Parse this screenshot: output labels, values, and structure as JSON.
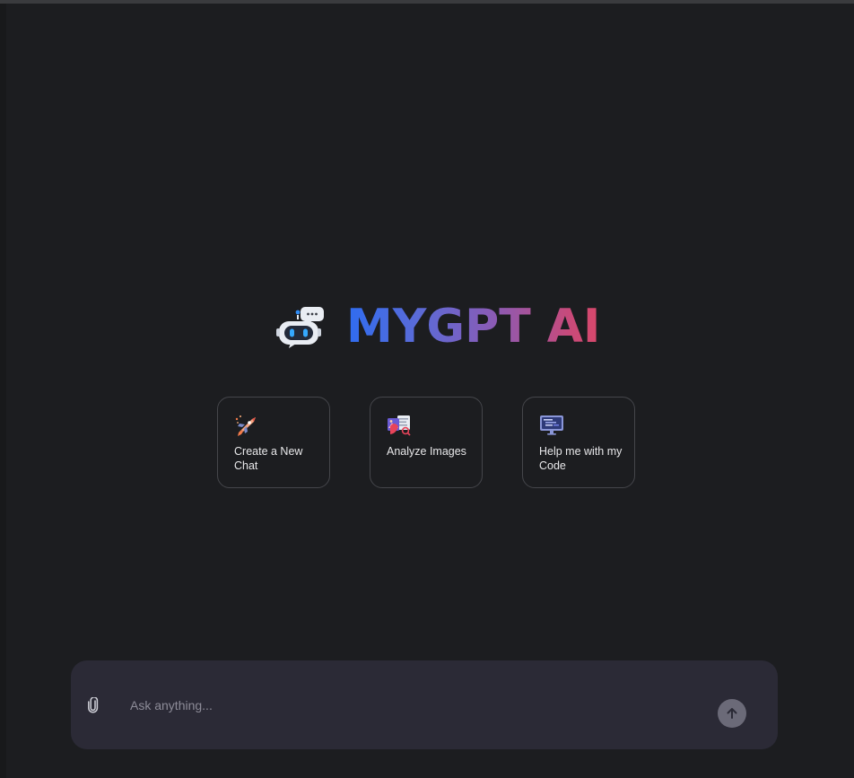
{
  "app": {
    "title": "MYGPT AI"
  },
  "logo": {
    "icon": "robot-chat-icon"
  },
  "suggestions": [
    {
      "label": "Create a New Chat",
      "icon": "rocket-icon"
    },
    {
      "label": "Analyze Images",
      "icon": "image-analysis-icon"
    },
    {
      "label": "Help me with my Code",
      "icon": "code-monitor-icon"
    }
  ],
  "composer": {
    "placeholder": "Ask anything...",
    "value": "",
    "attach_icon": "paperclip-icon",
    "send_icon": "arrow-up-icon"
  },
  "colors": {
    "background": "#1c1d20",
    "card_border": "#45464b",
    "composer_bg": "#2b2a36",
    "send_button": "#6b6a78",
    "title_gradient_start": "#2f6cf0",
    "title_gradient_end": "#d8486a"
  }
}
